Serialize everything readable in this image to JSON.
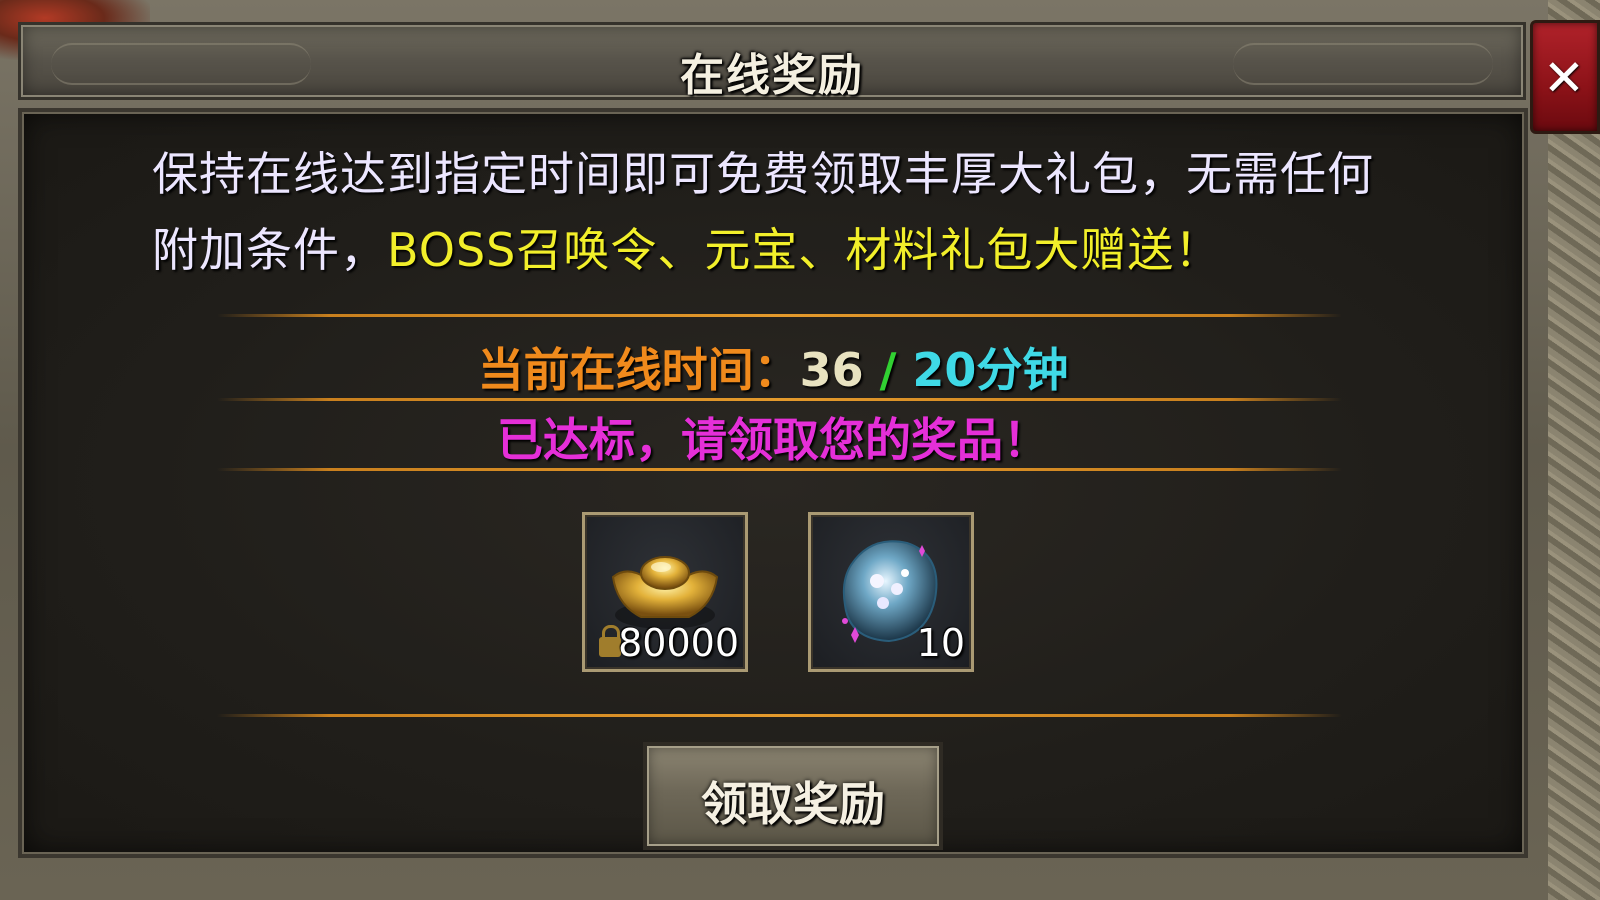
{
  "window": {
    "title": "在线奖励",
    "close_symbol": "✕"
  },
  "description": {
    "part1": "保持在线达到指定时间即可免费领取丰厚大礼包，无需任何附加条件，",
    "highlight": "BOSS召唤令、元宝、材料礼包大赠送！"
  },
  "online_time": {
    "label": "当前在线时间：",
    "current": "36",
    "separator": " / ",
    "target": "20分钟"
  },
  "status": "已达标，请领取您的奖品！",
  "rewards": [
    {
      "icon": "gold-ingot-icon",
      "count": "80000",
      "locked": true
    },
    {
      "icon": "spirit-gem-icon",
      "count": "10",
      "locked": false
    }
  ],
  "claim_button": {
    "label": "领取奖励"
  },
  "colors": {
    "time_label": "#f08a1c",
    "time_current": "#e8e2c0",
    "separator": "#31d132",
    "time_target": "#3fd9e6",
    "status": "#e52fd8",
    "highlight": "#f2ef2a",
    "close_button": "#b0222a"
  }
}
